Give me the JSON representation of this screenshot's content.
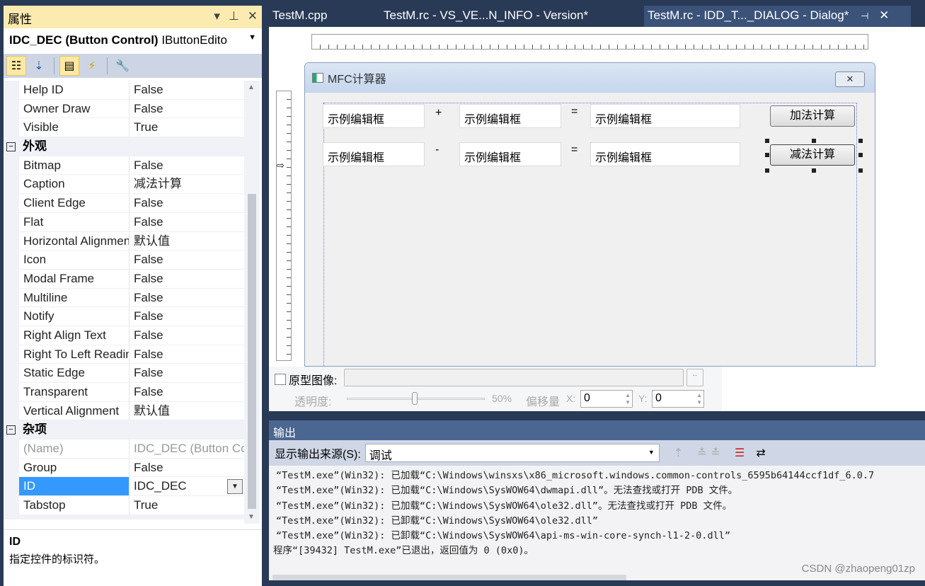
{
  "properties": {
    "title": "属性",
    "header_buttons": [
      "▾",
      "📌",
      "✕"
    ],
    "subject_name": "IDC_DEC (Button Control)",
    "subject_type": "IButtonEdito",
    "toolbar": [
      "categorized-icon",
      "alphabetical-icon",
      "properties-icon",
      "events-icon",
      "property-pages-icon"
    ],
    "rows": [
      {
        "n": "Help ID",
        "v": "False"
      },
      {
        "n": "Owner Draw",
        "v": "False"
      },
      {
        "n": "Visible",
        "v": "True"
      },
      {
        "cat": "外观"
      },
      {
        "n": "Bitmap",
        "v": "False"
      },
      {
        "n": "Caption",
        "v": "减法计算"
      },
      {
        "n": "Client Edge",
        "v": "False"
      },
      {
        "n": "Flat",
        "v": "False"
      },
      {
        "n": "Horizontal Alignment",
        "v": "默认值"
      },
      {
        "n": "Icon",
        "v": "False"
      },
      {
        "n": "Modal Frame",
        "v": "False"
      },
      {
        "n": "Multiline",
        "v": "False"
      },
      {
        "n": "Notify",
        "v": "False"
      },
      {
        "n": "Right Align Text",
        "v": "False"
      },
      {
        "n": "Right To Left Reading",
        "v": "False"
      },
      {
        "n": "Static Edge",
        "v": "False"
      },
      {
        "n": "Transparent",
        "v": "False"
      },
      {
        "n": "Vertical Alignment",
        "v": "默认值"
      },
      {
        "cat": "杂项"
      },
      {
        "n": "(Name)",
        "v": "IDC_DEC (Button Control)",
        "dim": true
      },
      {
        "n": "Group",
        "v": "False"
      },
      {
        "n": "ID",
        "v": "IDC_DEC",
        "sel": true
      },
      {
        "n": "Tabstop",
        "v": "True"
      }
    ],
    "description_title": "ID",
    "description_text": "指定控件的标识符。"
  },
  "tabs": [
    {
      "label": "TestM.cpp",
      "active": false
    },
    {
      "label": "TestM.rc - VS_VE...N_INFO - Version*",
      "active": false
    },
    {
      "label": "TestM.rc - IDD_T..._DIALOG - Dialog*",
      "active": true
    }
  ],
  "tab_buttons": {
    "pin": "⊣",
    "close": "✕"
  },
  "dialog": {
    "title": "MFC计算器",
    "close": "✕",
    "row1": {
      "a": "示例编辑框",
      "op": "+",
      "b": "示例编辑框",
      "eq": "=",
      "c": "示例编辑框",
      "button": "加法计算"
    },
    "row2": {
      "a": "示例编辑框",
      "op": "-",
      "b": "示例编辑框",
      "eq": "=",
      "c": "示例编辑框",
      "button": "减法计算"
    }
  },
  "prototype": {
    "checkbox_label": "原型图像:",
    "browse": "..",
    "opacity_label": "透明度:",
    "opacity_value": "50%",
    "opacity": 0.5,
    "offset_label": "偏移量",
    "x_label": "X:",
    "x_value": "0",
    "y_label": "Y:",
    "y_value": "0"
  },
  "output": {
    "title": "输出",
    "source_label": "显示输出来源(S):",
    "source_value": "调试",
    "lines": [
      "“TestM.exe”(Win32): 已加载“C:\\Windows\\winsxs\\x86_microsoft.windows.common-controls_6595b64144ccf1df_6.0.7",
      "“TestM.exe”(Win32): 已加载“C:\\Windows\\SysWOW64\\dwmapi.dll”。无法查找或打开 PDB 文件。",
      "“TestM.exe”(Win32): 已加载“C:\\Windows\\SysWOW64\\ole32.dll”。无法查找或打开 PDB 文件。",
      "“TestM.exe”(Win32): 已卸载“C:\\Windows\\SysWOW64\\ole32.dll”",
      "“TestM.exe”(Win32): 已卸载“C:\\Windows\\SysWOW64\\api-ms-win-core-synch-l1-2-0.dll”",
      "程序“[39432] TestM.exe”已退出，返回值为 0 (0x0)。"
    ]
  },
  "watermark": "CSDN @zhaopeng01zp"
}
